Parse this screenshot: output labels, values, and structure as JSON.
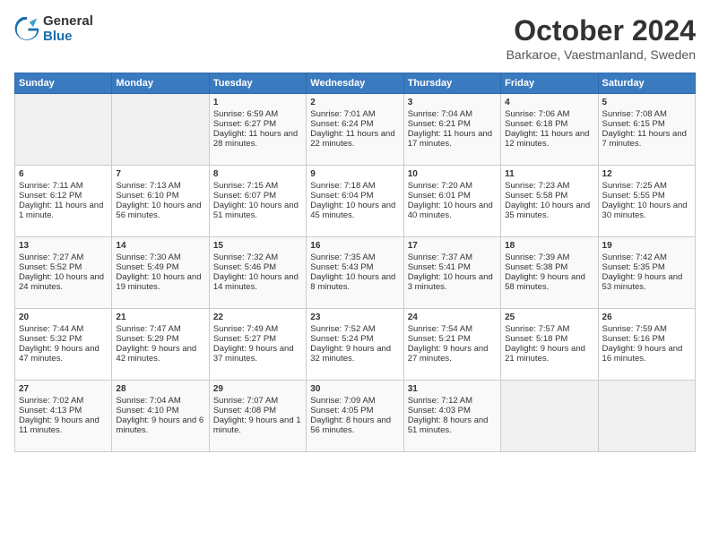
{
  "header": {
    "logo_general": "General",
    "logo_blue": "Blue",
    "month": "October 2024",
    "location": "Barkaroe, Vaestmanland, Sweden"
  },
  "days_of_week": [
    "Sunday",
    "Monday",
    "Tuesday",
    "Wednesday",
    "Thursday",
    "Friday",
    "Saturday"
  ],
  "weeks": [
    [
      {
        "day": "",
        "sunrise": "",
        "sunset": "",
        "daylight": ""
      },
      {
        "day": "",
        "sunrise": "",
        "sunset": "",
        "daylight": ""
      },
      {
        "day": "1",
        "sunrise": "Sunrise: 6:59 AM",
        "sunset": "Sunset: 6:27 PM",
        "daylight": "Daylight: 11 hours and 28 minutes."
      },
      {
        "day": "2",
        "sunrise": "Sunrise: 7:01 AM",
        "sunset": "Sunset: 6:24 PM",
        "daylight": "Daylight: 11 hours and 22 minutes."
      },
      {
        "day": "3",
        "sunrise": "Sunrise: 7:04 AM",
        "sunset": "Sunset: 6:21 PM",
        "daylight": "Daylight: 11 hours and 17 minutes."
      },
      {
        "day": "4",
        "sunrise": "Sunrise: 7:06 AM",
        "sunset": "Sunset: 6:18 PM",
        "daylight": "Daylight: 11 hours and 12 minutes."
      },
      {
        "day": "5",
        "sunrise": "Sunrise: 7:08 AM",
        "sunset": "Sunset: 6:15 PM",
        "daylight": "Daylight: 11 hours and 7 minutes."
      }
    ],
    [
      {
        "day": "6",
        "sunrise": "Sunrise: 7:11 AM",
        "sunset": "Sunset: 6:12 PM",
        "daylight": "Daylight: 11 hours and 1 minute."
      },
      {
        "day": "7",
        "sunrise": "Sunrise: 7:13 AM",
        "sunset": "Sunset: 6:10 PM",
        "daylight": "Daylight: 10 hours and 56 minutes."
      },
      {
        "day": "8",
        "sunrise": "Sunrise: 7:15 AM",
        "sunset": "Sunset: 6:07 PM",
        "daylight": "Daylight: 10 hours and 51 minutes."
      },
      {
        "day": "9",
        "sunrise": "Sunrise: 7:18 AM",
        "sunset": "Sunset: 6:04 PM",
        "daylight": "Daylight: 10 hours and 45 minutes."
      },
      {
        "day": "10",
        "sunrise": "Sunrise: 7:20 AM",
        "sunset": "Sunset: 6:01 PM",
        "daylight": "Daylight: 10 hours and 40 minutes."
      },
      {
        "day": "11",
        "sunrise": "Sunrise: 7:23 AM",
        "sunset": "Sunset: 5:58 PM",
        "daylight": "Daylight: 10 hours and 35 minutes."
      },
      {
        "day": "12",
        "sunrise": "Sunrise: 7:25 AM",
        "sunset": "Sunset: 5:55 PM",
        "daylight": "Daylight: 10 hours and 30 minutes."
      }
    ],
    [
      {
        "day": "13",
        "sunrise": "Sunrise: 7:27 AM",
        "sunset": "Sunset: 5:52 PM",
        "daylight": "Daylight: 10 hours and 24 minutes."
      },
      {
        "day": "14",
        "sunrise": "Sunrise: 7:30 AM",
        "sunset": "Sunset: 5:49 PM",
        "daylight": "Daylight: 10 hours and 19 minutes."
      },
      {
        "day": "15",
        "sunrise": "Sunrise: 7:32 AM",
        "sunset": "Sunset: 5:46 PM",
        "daylight": "Daylight: 10 hours and 14 minutes."
      },
      {
        "day": "16",
        "sunrise": "Sunrise: 7:35 AM",
        "sunset": "Sunset: 5:43 PM",
        "daylight": "Daylight: 10 hours and 8 minutes."
      },
      {
        "day": "17",
        "sunrise": "Sunrise: 7:37 AM",
        "sunset": "Sunset: 5:41 PM",
        "daylight": "Daylight: 10 hours and 3 minutes."
      },
      {
        "day": "18",
        "sunrise": "Sunrise: 7:39 AM",
        "sunset": "Sunset: 5:38 PM",
        "daylight": "Daylight: 9 hours and 58 minutes."
      },
      {
        "day": "19",
        "sunrise": "Sunrise: 7:42 AM",
        "sunset": "Sunset: 5:35 PM",
        "daylight": "Daylight: 9 hours and 53 minutes."
      }
    ],
    [
      {
        "day": "20",
        "sunrise": "Sunrise: 7:44 AM",
        "sunset": "Sunset: 5:32 PM",
        "daylight": "Daylight: 9 hours and 47 minutes."
      },
      {
        "day": "21",
        "sunrise": "Sunrise: 7:47 AM",
        "sunset": "Sunset: 5:29 PM",
        "daylight": "Daylight: 9 hours and 42 minutes."
      },
      {
        "day": "22",
        "sunrise": "Sunrise: 7:49 AM",
        "sunset": "Sunset: 5:27 PM",
        "daylight": "Daylight: 9 hours and 37 minutes."
      },
      {
        "day": "23",
        "sunrise": "Sunrise: 7:52 AM",
        "sunset": "Sunset: 5:24 PM",
        "daylight": "Daylight: 9 hours and 32 minutes."
      },
      {
        "day": "24",
        "sunrise": "Sunrise: 7:54 AM",
        "sunset": "Sunset: 5:21 PM",
        "daylight": "Daylight: 9 hours and 27 minutes."
      },
      {
        "day": "25",
        "sunrise": "Sunrise: 7:57 AM",
        "sunset": "Sunset: 5:18 PM",
        "daylight": "Daylight: 9 hours and 21 minutes."
      },
      {
        "day": "26",
        "sunrise": "Sunrise: 7:59 AM",
        "sunset": "Sunset: 5:16 PM",
        "daylight": "Daylight: 9 hours and 16 minutes."
      }
    ],
    [
      {
        "day": "27",
        "sunrise": "Sunrise: 7:02 AM",
        "sunset": "Sunset: 4:13 PM",
        "daylight": "Daylight: 9 hours and 11 minutes."
      },
      {
        "day": "28",
        "sunrise": "Sunrise: 7:04 AM",
        "sunset": "Sunset: 4:10 PM",
        "daylight": "Daylight: 9 hours and 6 minutes."
      },
      {
        "day": "29",
        "sunrise": "Sunrise: 7:07 AM",
        "sunset": "Sunset: 4:08 PM",
        "daylight": "Daylight: 9 hours and 1 minute."
      },
      {
        "day": "30",
        "sunrise": "Sunrise: 7:09 AM",
        "sunset": "Sunset: 4:05 PM",
        "daylight": "Daylight: 8 hours and 56 minutes."
      },
      {
        "day": "31",
        "sunrise": "Sunrise: 7:12 AM",
        "sunset": "Sunset: 4:03 PM",
        "daylight": "Daylight: 8 hours and 51 minutes."
      },
      {
        "day": "",
        "sunrise": "",
        "sunset": "",
        "daylight": ""
      },
      {
        "day": "",
        "sunrise": "",
        "sunset": "",
        "daylight": ""
      }
    ]
  ]
}
